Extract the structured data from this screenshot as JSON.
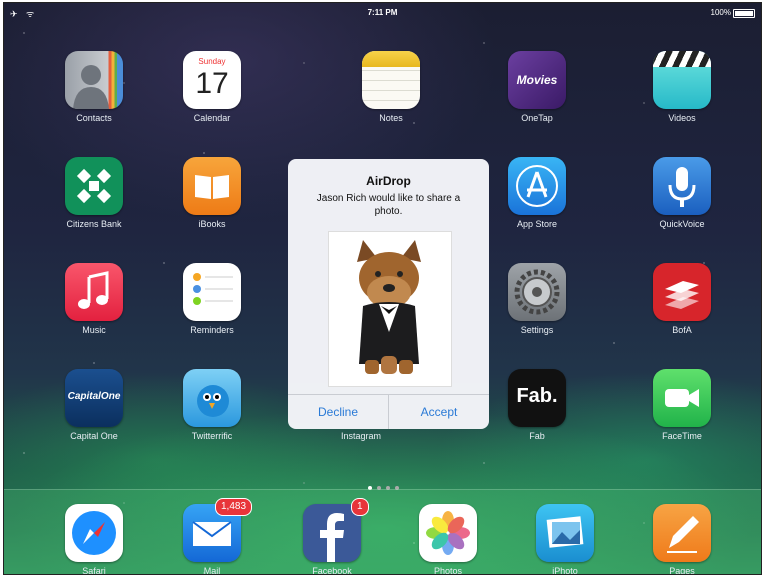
{
  "status": {
    "left": "✈ ︎ᯤ",
    "time": "7:11 PM",
    "battery": "100%"
  },
  "apps": {
    "contacts": "Contacts",
    "calendar": "Calendar",
    "calendar_day": "Sunday",
    "calendar_date": "17",
    "notes": "Notes",
    "onetap": "OneTap",
    "onetap_text": "Movies",
    "videos": "Videos",
    "citizens": "Citizens Bank",
    "ibooks": "iBooks",
    "appstore": "App Store",
    "quickvoice": "QuickVoice",
    "music": "Music",
    "reminders": "Reminders",
    "settings": "Settings",
    "bofa": "BofA",
    "capitalone": "Capital One",
    "capitalone_text": "CapitalOne",
    "twitterrific": "Twitterrific",
    "instagram": "Instagram",
    "fab": "Fab",
    "fab_text": "Fab.",
    "facetime": "FaceTime"
  },
  "dock": {
    "safari": "Safari",
    "mail": "Mail",
    "mail_badge": "1,483",
    "facebook": "Facebook",
    "facebook_badge": "1",
    "photos": "Photos",
    "iphoto": "iPhoto",
    "pages": "Pages"
  },
  "airdrop": {
    "title": "AirDrop",
    "message": "Jason Rich would like to share a photo.",
    "decline": "Decline",
    "accept": "Accept"
  },
  "colors": {
    "accent": "#2a7ad6",
    "badge": "#e8353a"
  }
}
